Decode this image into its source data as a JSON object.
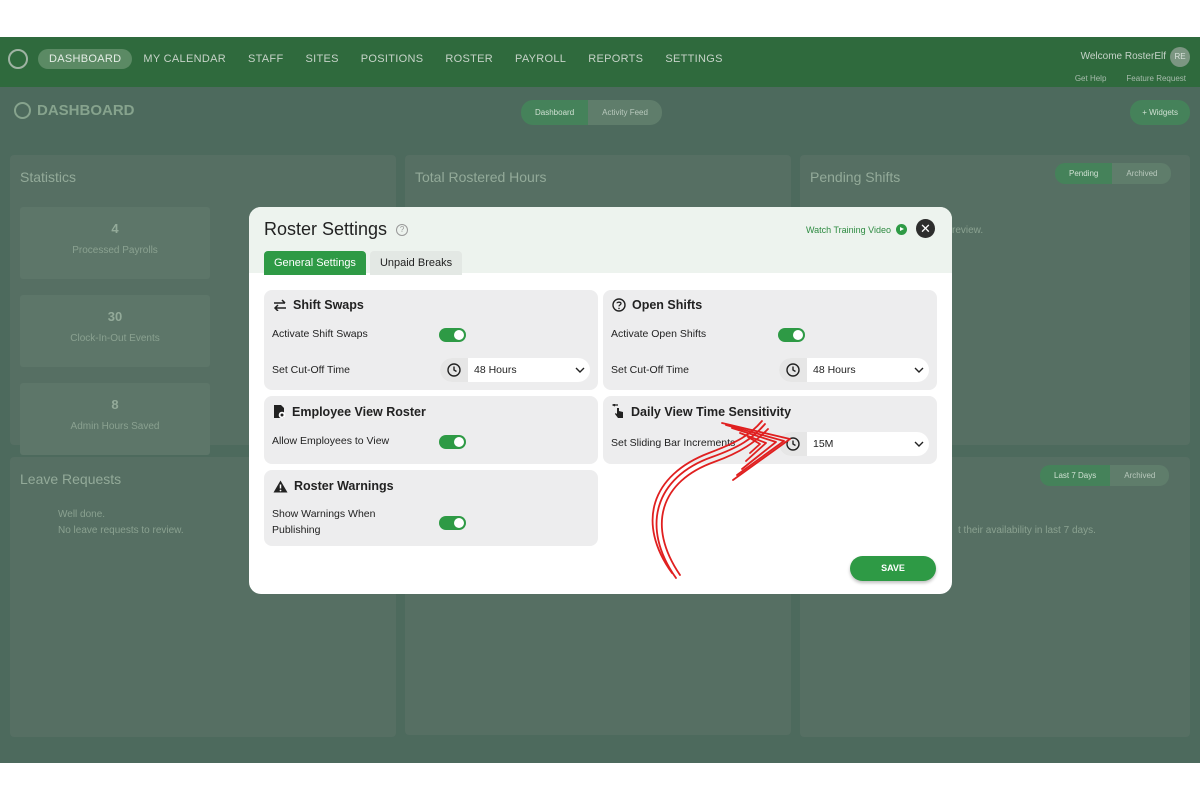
{
  "nav": {
    "items": [
      "DASHBOARD",
      "MY CALENDAR",
      "STAFF",
      "SITES",
      "POSITIONS",
      "ROSTER",
      "PAYROLL",
      "REPORTS",
      "SETTINGS"
    ],
    "welcome": "Welcome RosterElf",
    "avatar": "RE",
    "get_help": "Get Help",
    "feature_request": "Feature Request"
  },
  "dashboard": {
    "title": "DASHBOARD",
    "seg_dashboard": "Dashboard",
    "seg_activity": "Activity Feed",
    "widgets_button": "+ Widgets",
    "statistics": {
      "title": "Statistics",
      "stats": [
        {
          "value": "4",
          "label": "Processed Payrolls"
        },
        {
          "value": "30",
          "label": "Clock-In-Out Events"
        },
        {
          "value": "8",
          "label": "Admin Hours Saved"
        }
      ]
    },
    "total_rostered_title": "Total Rostered Hours",
    "pending_shifts": {
      "title": "Pending Shifts",
      "pending": "Pending",
      "archived": "Archived",
      "text": "review."
    },
    "leave_requests": {
      "title": "Leave Requests",
      "line1": "Well done.",
      "line2": "No leave requests to review."
    },
    "availability": {
      "last7": "Last 7 Days",
      "archived": "Archived",
      "text": "t their availability in last 7 days."
    }
  },
  "modal": {
    "title": "Roster Settings",
    "training_link": "Watch Training Video",
    "tabs": [
      "General Settings",
      "Unpaid Breaks"
    ],
    "shift_swaps": {
      "title": "Shift Swaps",
      "activate_label": "Activate Shift Swaps",
      "cutoff_label": "Set Cut-Off Time",
      "cutoff_value": "48 Hours"
    },
    "open_shifts": {
      "title": "Open Shifts",
      "activate_label": "Activate Open Shifts",
      "cutoff_label": "Set Cut-Off Time",
      "cutoff_value": "48 Hours"
    },
    "employee_view": {
      "title": "Employee View Roster",
      "allow_label": "Allow Employees to View"
    },
    "daily_view": {
      "title": "Daily View Time Sensitivity",
      "increment_label": "Set Sliding Bar Increments",
      "increment_value": "15M"
    },
    "roster_warnings": {
      "title": "Roster Warnings",
      "show_label_line1": "Show Warnings When",
      "show_label_line2": "Publishing"
    },
    "save_label": "SAVE"
  },
  "colors": {
    "accent": "#2e9a45",
    "overlay": "#4d6a5d",
    "annotation": "#e02020"
  }
}
